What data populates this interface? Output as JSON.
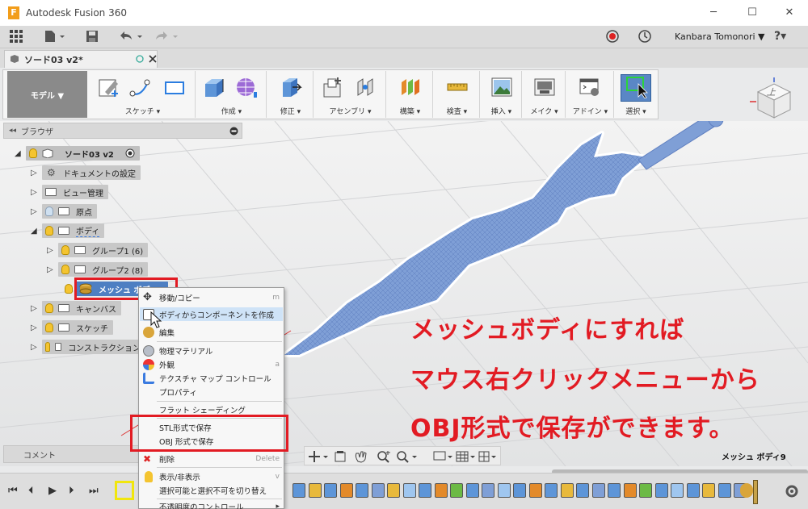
{
  "window": {
    "app_logo": "F",
    "title": "Autodesk Fusion 360",
    "controls": {
      "minimize": "─",
      "maximize": "☐",
      "close": "✕"
    }
  },
  "quick_access": {
    "user_name": "Kanbara Tomonori ▼",
    "help": "?▾"
  },
  "tab": {
    "label": "ソード03 v2*"
  },
  "ribbon": {
    "workspace": "モデル ▼",
    "groups": [
      {
        "label": "スケッチ ▾"
      },
      {
        "label": "作成 ▾"
      },
      {
        "label": "修正 ▾"
      },
      {
        "label": "アセンブリ ▾"
      },
      {
        "label": "構築 ▾"
      },
      {
        "label": "検査 ▾"
      },
      {
        "label": "挿入 ▾"
      },
      {
        "label": "メイク ▾"
      },
      {
        "label": "アドイン ▾"
      },
      {
        "label": "選択 ▾"
      }
    ]
  },
  "viewcube": {
    "label": "上"
  },
  "browser": {
    "title": "ブラウザ",
    "items": [
      {
        "label": "ソード03 v2"
      },
      {
        "label": "ドキュメントの設定"
      },
      {
        "label": "ビュー管理"
      },
      {
        "label": "原点"
      },
      {
        "label": "ボディ"
      },
      {
        "label": "グループ1 (6)"
      },
      {
        "label": "グループ2 (8)"
      },
      {
        "label": "メッシュ ボディ9"
      },
      {
        "label": "キャンバス"
      },
      {
        "label": "スケッチ"
      },
      {
        "label": "コンストラクション"
      }
    ]
  },
  "context_menu": {
    "items": [
      {
        "label": "移動/コピー",
        "shortcut": "m"
      },
      {
        "label": "ボディからコンポーネントを作成",
        "shortcut": ""
      },
      {
        "label": "編集",
        "shortcut": ""
      },
      {
        "label": "物理マテリアル",
        "shortcut": ""
      },
      {
        "label": "外観",
        "shortcut": "a"
      },
      {
        "label": "テクスチャ マップ コントロール",
        "shortcut": ""
      },
      {
        "label": "プロパティ",
        "shortcut": ""
      },
      {
        "label": "フラット シェーディング",
        "shortcut": ""
      },
      {
        "label": "STL形式で保存",
        "shortcut": ""
      },
      {
        "label": "OBJ 形式で保存",
        "shortcut": ""
      },
      {
        "label": "削除",
        "shortcut": "Delete"
      },
      {
        "label": "表示/非表示",
        "shortcut": "v"
      },
      {
        "label": "選択可能と選択不可を切り替え",
        "shortcut": ""
      },
      {
        "label": "不透明度のコントロール",
        "shortcut": ""
      }
    ]
  },
  "annotation": {
    "line1": "メッシュボディにすれば",
    "line2": "マウス右クリックメニューから",
    "line3": "OBJ形式で保存ができます。"
  },
  "comments": {
    "label": "コメント"
  },
  "status": {
    "selected_name": "メッシュ ボディ9"
  },
  "colors": {
    "accent_red": "#e21b23",
    "mesh_blue": "#7f9fd6",
    "workspace_gray": "#8a8a8a",
    "highlight": "#cfe3f7"
  }
}
